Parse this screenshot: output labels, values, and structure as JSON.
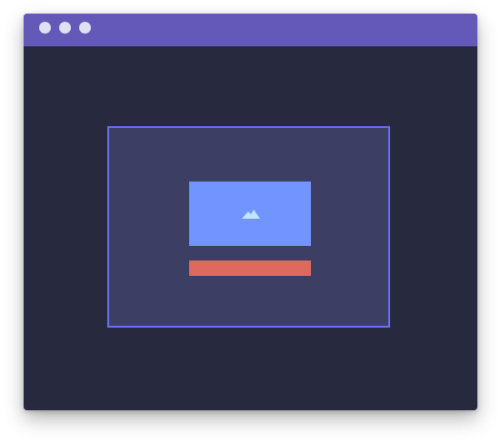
{
  "window": {
    "titlebar_color": "#6459b8",
    "background_color": "#272a3f",
    "controls": [
      {
        "name": "window-dot-1",
        "color": "#dfe0f2"
      },
      {
        "name": "window-dot-2",
        "color": "#dfe0f2"
      },
      {
        "name": "window-dot-3",
        "color": "#dfe0f2"
      }
    ]
  },
  "frame": {
    "background_color": "#3c3f63",
    "border_color": "#6c6ff0"
  },
  "image_placeholder": {
    "icon": "mountain-icon",
    "background_color": "#7294ff",
    "icon_color": "#bfe7ff"
  },
  "bar": {
    "color": "#e0695e"
  }
}
